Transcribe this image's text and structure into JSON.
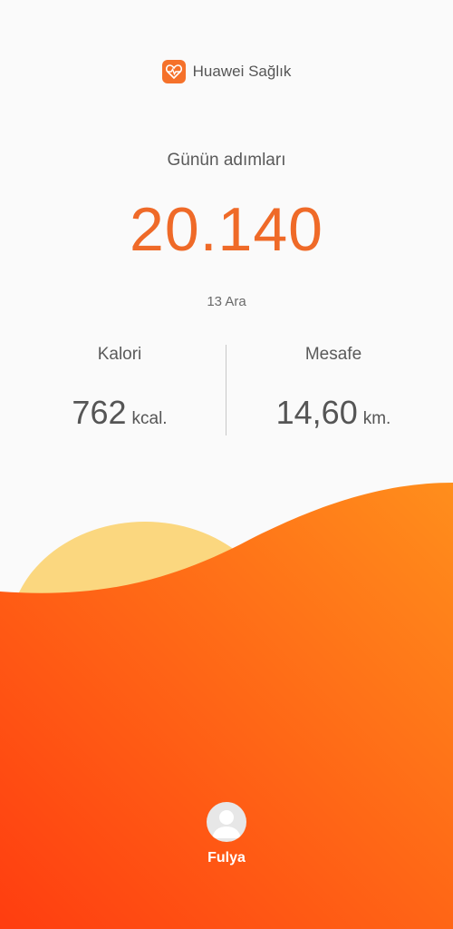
{
  "header": {
    "app_name": "Huawei Sağlık",
    "icon": "health-heart-icon"
  },
  "steps": {
    "label": "Günün adımları",
    "value": "20.140",
    "date": "13 Ara"
  },
  "stats": {
    "calories": {
      "label": "Kalori",
      "value": "762",
      "unit": "kcal."
    },
    "distance": {
      "label": "Mesafe",
      "value": "14,60",
      "unit": "km."
    }
  },
  "user": {
    "name": "Fulya",
    "avatar_icon": "person-avatar-icon"
  },
  "colors": {
    "accent": "#ef6a28",
    "wave_dark": "#ff4a12",
    "wave_light": "#ff8a1a",
    "sun": "#fbd77f"
  }
}
